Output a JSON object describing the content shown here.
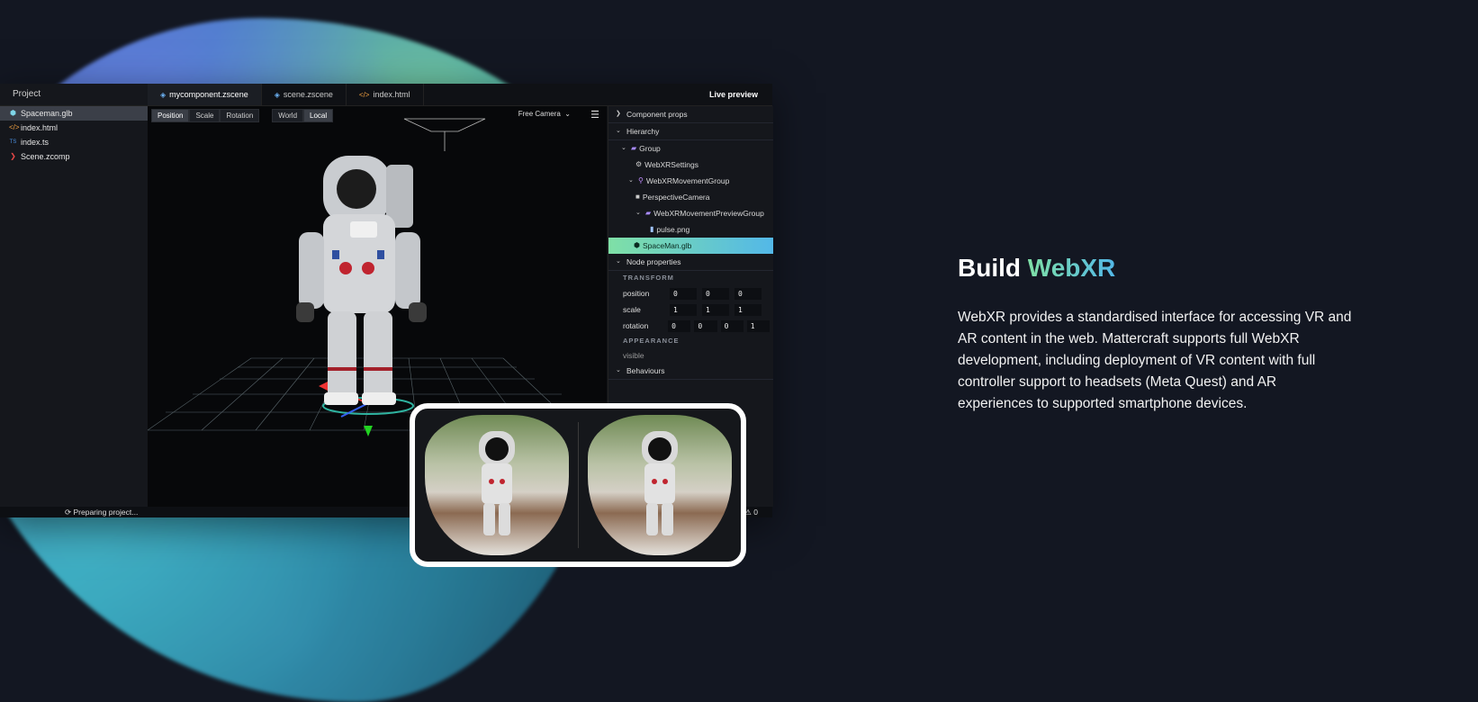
{
  "left_panel": {
    "title": "Project",
    "files": [
      {
        "name": "Spaceman.glb",
        "icon": "cube-icon",
        "selected": true
      },
      {
        "name": "index.html",
        "icon": "code-icon",
        "selected": false
      },
      {
        "name": "index.ts",
        "icon": "ts-icon",
        "selected": false
      },
      {
        "name": "Scene.zcomp",
        "icon": "component-icon",
        "selected": false
      }
    ]
  },
  "tabs": [
    {
      "label": "mycomponent.zscene",
      "active": true
    },
    {
      "label": "scene.zscene",
      "active": false
    },
    {
      "label": "index.html",
      "active": false
    }
  ],
  "live_preview": "Live preview",
  "toolbar": {
    "position": "Position",
    "scale": "Scale",
    "rotation": "Rotation",
    "world": "World",
    "local": "Local",
    "camera": "Free Camera"
  },
  "right_panel": {
    "component_props": "Component props",
    "hierarchy": "Hierarchy",
    "nodes": [
      {
        "label": "Group",
        "depth": 1
      },
      {
        "label": "WebXRSettings",
        "depth": 2
      },
      {
        "label": "WebXRMovementGroup",
        "depth": 2
      },
      {
        "label": "PerspectiveCamera",
        "depth": 3
      },
      {
        "label": "WebXRMovementPreviewGroup",
        "depth": 3
      },
      {
        "label": "pulse.png",
        "depth": 4
      },
      {
        "label": "SpaceMan.glb",
        "depth": 2
      }
    ],
    "node_properties": "Node properties",
    "transform": "TRANSFORM",
    "position_label": "position",
    "position": [
      "0",
      "0",
      "0"
    ],
    "scale_label": "scale",
    "scale": [
      "1",
      "1",
      "1"
    ],
    "rotation_label": "rotation",
    "rotation": [
      "0",
      "0",
      "0",
      "1"
    ],
    "appearance": "APPEARANCE",
    "visible": "visible",
    "behaviours": "Behaviours"
  },
  "status": {
    "left": "Preparing project...",
    "right": "0"
  },
  "headline": {
    "prefix": "Build ",
    "accent": "WebXR"
  },
  "paragraph": "WebXR provides a standardised interface for accessing VR and AR content in the web. Mattercraft supports full WebXR development, including deployment of VR content with full controller support to headsets (Meta Quest) and AR experiences to supported smartphone devices."
}
